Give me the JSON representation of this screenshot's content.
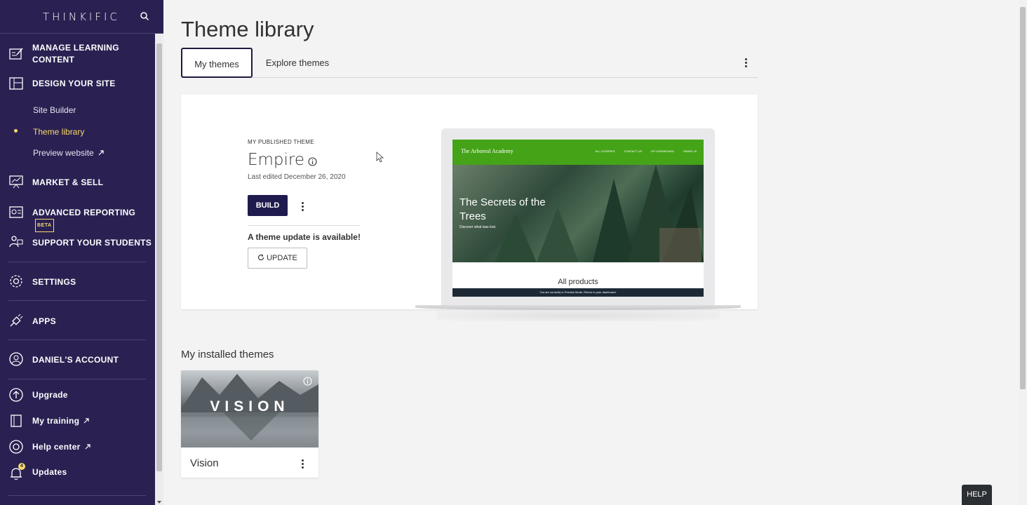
{
  "brand": {
    "logo": "THINKIFIC"
  },
  "sidebar": {
    "items": [
      {
        "label": "MANAGE LEARNING CONTENT"
      },
      {
        "label": "DESIGN YOUR SITE"
      },
      {
        "label": "MARKET & SELL"
      },
      {
        "label": "ADVANCED REPORTING",
        "badge": "BETA"
      },
      {
        "label": "SUPPORT YOUR STUDENTS"
      },
      {
        "label": "SETTINGS"
      },
      {
        "label": "APPS"
      },
      {
        "label": "DANIEL'S ACCOUNT"
      }
    ],
    "subitems": [
      {
        "label": "Site Builder"
      },
      {
        "label": "Theme library"
      },
      {
        "label": "Preview website"
      }
    ],
    "footer": [
      {
        "label": "Upgrade"
      },
      {
        "label": "My training"
      },
      {
        "label": "Help center"
      },
      {
        "label": "Updates",
        "badge": "4"
      }
    ]
  },
  "main": {
    "title": "Theme library",
    "tabs": [
      {
        "label": "My themes"
      },
      {
        "label": "Explore themes"
      }
    ],
    "published": {
      "section_label": "MY PUBLISHED THEME",
      "name": "Empire",
      "last_edited": "Last edited December 26, 2020",
      "build_label": "BUILD",
      "update_message": "A theme update is available!",
      "update_label": "UPDATE"
    },
    "preview": {
      "site_name": "The Arboreal Academy",
      "nav_links": [
        "ALL COURSES",
        "CONTACT US",
        "MY DASHBOARD",
        "DANIEL W"
      ],
      "hero_title": "The Secrets of the Trees",
      "hero_subtitle": "Discover what was lost.",
      "all_products": "All products",
      "preview_bar": "You are currently in Preview Mode. Return to your dashboard."
    },
    "installed": {
      "title": "My installed themes",
      "themes": [
        {
          "name": "Vision",
          "thumb_text": "VISION"
        }
      ]
    }
  },
  "help": {
    "label": "HELP"
  },
  "colors": {
    "sidebar": "#2a2152",
    "accent": "#f6d86b",
    "primary_button": "#1f1b4e",
    "site_nav": "#45a318"
  }
}
